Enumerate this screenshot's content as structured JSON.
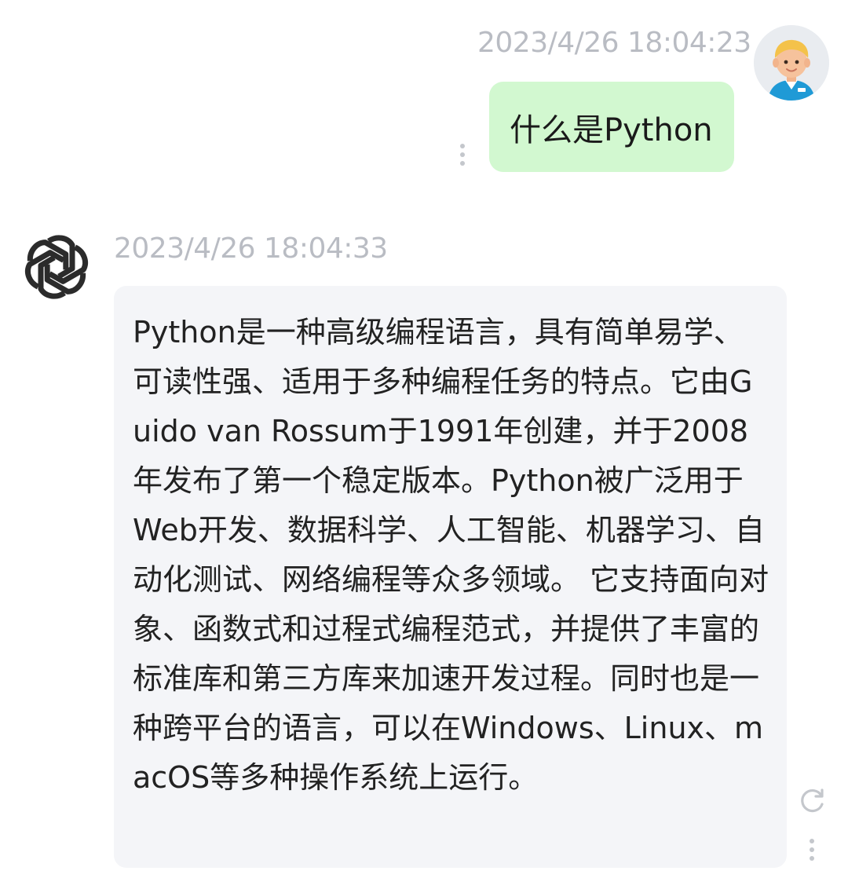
{
  "messages": {
    "user": {
      "timestamp": "2023/4/26 18:04:23",
      "text": "什么是Python",
      "avatar_icon": "cartoon-user-avatar-icon"
    },
    "assistant": {
      "timestamp": "2023/4/26 18:04:33",
      "text": "Python是一种高级编程语言，具有简单易学、可读性强、适用于多种编程任务的特点。它由Guido van Rossum于1991年创建，并于2008年发布了第一个稳定版本。Python被广泛用于Web开发、数据科学、人工智能、机器学习、自动化测试、网络编程等众多领域。 它支持面向对象、函数式和过程式编程范式，并提供了丰富的标准库和第三方库来加速开发过程。同时也是一种跨平台的语言，可以在Windows、Linux、macOS等多种操作系统上运行。",
      "avatar_icon": "openai-logo-icon"
    }
  },
  "icons": {
    "more": "more-vertical-icon",
    "regenerate": "refresh-icon"
  },
  "colors": {
    "user_bubble": "#d2f8d0",
    "assistant_bubble": "#f4f5f8",
    "timestamp": "#b9bcc3",
    "text": "#222222"
  }
}
